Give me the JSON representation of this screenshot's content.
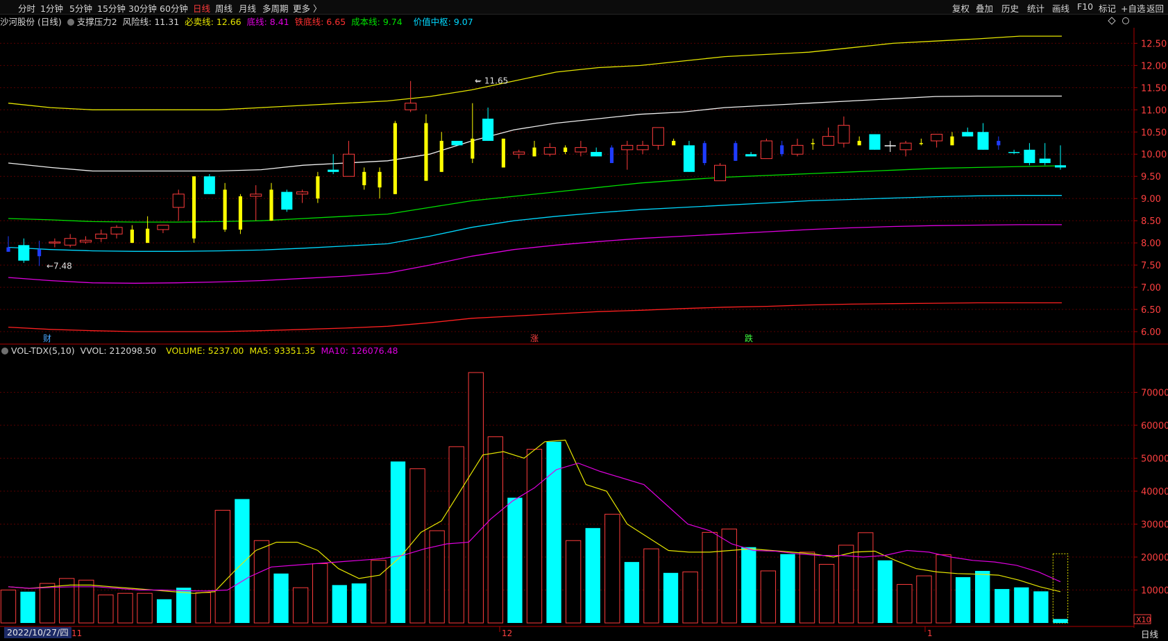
{
  "toolbar": {
    "periods": [
      "分时",
      "1分钟",
      "5分钟",
      "15分钟",
      "30分钟",
      "60分钟",
      "日线",
      "周线",
      "月线",
      "多周期",
      "更多 〉"
    ],
    "active_period": "日线",
    "right_buttons": [
      "复权",
      "叠加",
      "历史",
      "统计",
      "画线",
      "F10",
      "标记",
      "+自选",
      "返回"
    ]
  },
  "info": {
    "stock": "沙河股份 (日线)",
    "indicator": "支撑压力2",
    "risk": "风险线: 11.31",
    "must_sell": "必卖线: 12.66",
    "bottom": "底线: 8.41",
    "iron_bottom": "铁底线: 6.65",
    "cost": "成本线: 9.74",
    "value_center": "价值中枢: 9.07"
  },
  "vol_info": {
    "name": "VOL-TDX(5,10)",
    "vvol": "VVOL: 212098.50",
    "volume": "VOLUME: 5237.00",
    "ma5": "MA5: 93351.35",
    "ma10": "MA10: 126076.48"
  },
  "annotations": {
    "high": "11.65",
    "low": "7.48",
    "cai": "财",
    "zhang": "涨",
    "die": "跌",
    "x10": "X10"
  },
  "x_labels": [
    "11",
    "12",
    "1"
  ],
  "bottom": {
    "date": "2022/10/27/四",
    "period": "日线"
  },
  "colors": {
    "up": "#ff3c3c",
    "down": "#00ffff",
    "yellow_candle": "#ffff00",
    "blue_candle": "#1f3cff",
    "must_sell": "#e6e600",
    "risk": "#f0f0f0",
    "cost": "#00e000",
    "value_center": "#00d8ff",
    "bottom": "#e000e0",
    "iron_bottom": "#ff2020",
    "ma5": "#e6e600",
    "ma10": "#e000e0"
  },
  "chart_data": [
    {
      "type": "candlestick",
      "title": "沙河股份 (日线)",
      "y_ticks": [
        12.5,
        12.0,
        11.5,
        11.0,
        10.5,
        10.0,
        9.5,
        9.0,
        8.5,
        8.0,
        7.5,
        7.0,
        6.5,
        6.0
      ],
      "ylim": [
        5.75,
        12.85
      ],
      "candles": [
        {
          "o": 7.9,
          "h": 8.15,
          "l": 7.8,
          "c": 7.8,
          "t": "down_blue"
        },
        {
          "o": 7.95,
          "h": 8.1,
          "l": 7.55,
          "c": 7.6,
          "t": "down"
        },
        {
          "o": 7.85,
          "h": 8.05,
          "l": 7.48,
          "c": 7.7,
          "t": "down_blue"
        },
        {
          "o": 8.0,
          "h": 8.1,
          "l": 7.9,
          "c": 8.02,
          "t": "up"
        },
        {
          "o": 7.95,
          "h": 8.2,
          "l": 7.9,
          "c": 8.1,
          "t": "up"
        },
        {
          "o": 8.02,
          "h": 8.15,
          "l": 7.98,
          "c": 8.06,
          "t": "up"
        },
        {
          "o": 8.1,
          "h": 8.3,
          "l": 8.02,
          "c": 8.2,
          "t": "up"
        },
        {
          "o": 8.2,
          "h": 8.4,
          "l": 8.1,
          "c": 8.35,
          "t": "up"
        },
        {
          "o": 8.3,
          "h": 8.4,
          "l": 8.0,
          "c": 8.0,
          "t": "down_yellow"
        },
        {
          "o": 8.32,
          "h": 8.6,
          "l": 8.0,
          "c": 8.0,
          "t": "down_yellow"
        },
        {
          "o": 8.3,
          "h": 8.4,
          "l": 8.22,
          "c": 8.4,
          "t": "up"
        },
        {
          "o": 8.8,
          "h": 9.2,
          "l": 8.5,
          "c": 9.1,
          "t": "up"
        },
        {
          "o": 9.5,
          "h": 9.5,
          "l": 8.0,
          "c": 8.1,
          "t": "down_yellow"
        },
        {
          "o": 9.5,
          "h": 9.55,
          "l": 9.1,
          "c": 9.1,
          "t": "down"
        },
        {
          "o": 9.2,
          "h": 9.35,
          "l": 8.25,
          "c": 8.3,
          "t": "down_yellow"
        },
        {
          "o": 9.05,
          "h": 9.1,
          "l": 8.2,
          "c": 8.3,
          "t": "down_yellow"
        },
        {
          "o": 9.05,
          "h": 9.3,
          "l": 8.5,
          "c": 9.1,
          "t": "up"
        },
        {
          "o": 9.2,
          "h": 9.35,
          "l": 8.5,
          "c": 8.5,
          "t": "down_yellow"
        },
        {
          "o": 9.15,
          "h": 9.2,
          "l": 8.7,
          "c": 8.75,
          "t": "down"
        },
        {
          "o": 9.1,
          "h": 9.2,
          "l": 8.9,
          "c": 9.15,
          "t": "up"
        },
        {
          "o": 9.5,
          "h": 9.6,
          "l": 8.9,
          "c": 9.0,
          "t": "down_yellow"
        },
        {
          "o": 9.65,
          "h": 10.0,
          "l": 9.55,
          "c": 9.6,
          "t": "down"
        },
        {
          "o": 9.5,
          "h": 10.3,
          "l": 9.5,
          "c": 10.0,
          "t": "up"
        },
        {
          "o": 9.6,
          "h": 9.7,
          "l": 9.2,
          "c": 9.3,
          "t": "down_yellow"
        },
        {
          "o": 9.6,
          "h": 9.7,
          "l": 9.0,
          "c": 9.25,
          "t": "down_yellow"
        },
        {
          "o": 10.7,
          "h": 10.75,
          "l": 9.1,
          "c": 9.1,
          "t": "down_yellow"
        },
        {
          "o": 11.0,
          "h": 11.65,
          "l": 10.95,
          "c": 11.15,
          "t": "up"
        },
        {
          "o": 10.7,
          "h": 10.9,
          "l": 9.4,
          "c": 9.4,
          "t": "down_yellow"
        },
        {
          "o": 10.3,
          "h": 10.5,
          "l": 9.6,
          "c": 9.6,
          "t": "down_yellow"
        },
        {
          "o": 10.3,
          "h": 10.3,
          "l": 10.2,
          "c": 10.2,
          "t": "down"
        },
        {
          "o": 10.35,
          "h": 11.15,
          "l": 9.8,
          "c": 9.9,
          "t": "down_yellow"
        },
        {
          "o": 10.8,
          "h": 11.05,
          "l": 10.3,
          "c": 10.3,
          "t": "down"
        },
        {
          "o": 10.35,
          "h": 10.35,
          "l": 9.7,
          "c": 9.7,
          "t": "down_yellow"
        },
        {
          "o": 10.0,
          "h": 10.1,
          "l": 9.9,
          "c": 10.05,
          "t": "up"
        },
        {
          "o": 10.15,
          "h": 10.3,
          "l": 9.95,
          "c": 9.95,
          "t": "down_yellow"
        },
        {
          "o": 10.0,
          "h": 10.25,
          "l": 9.95,
          "c": 10.15,
          "t": "up"
        },
        {
          "o": 10.15,
          "h": 10.2,
          "l": 10.0,
          "c": 10.05,
          "t": "down_yellow"
        },
        {
          "o": 10.15,
          "h": 10.3,
          "l": 9.95,
          "c": 10.05,
          "t": "up"
        },
        {
          "o": 10.05,
          "h": 10.15,
          "l": 9.95,
          "c": 9.95,
          "t": "down"
        },
        {
          "o": 10.15,
          "h": 10.2,
          "l": 9.8,
          "c": 9.8,
          "t": "down_blue"
        },
        {
          "o": 10.2,
          "h": 10.3,
          "l": 9.65,
          "c": 10.1,
          "t": "up"
        },
        {
          "o": 10.1,
          "h": 10.3,
          "l": 10.0,
          "c": 10.2,
          "t": "up"
        },
        {
          "o": 10.2,
          "h": 10.6,
          "l": 10.1,
          "c": 10.6,
          "t": "up"
        },
        {
          "o": 10.3,
          "h": 10.35,
          "l": 10.2,
          "c": 10.2,
          "t": "down_yellow"
        },
        {
          "o": 10.2,
          "h": 10.3,
          "l": 9.6,
          "c": 9.6,
          "t": "down"
        },
        {
          "o": 10.25,
          "h": 10.3,
          "l": 9.75,
          "c": 9.8,
          "t": "down_blue"
        },
        {
          "o": 9.4,
          "h": 9.8,
          "l": 9.4,
          "c": 9.75,
          "t": "up"
        },
        {
          "o": 10.25,
          "h": 10.3,
          "l": 9.85,
          "c": 9.85,
          "t": "down_blue"
        },
        {
          "o": 10.0,
          "h": 10.05,
          "l": 9.95,
          "c": 9.95,
          "t": "down"
        },
        {
          "o": 9.9,
          "h": 10.35,
          "l": 9.9,
          "c": 10.3,
          "t": "up"
        },
        {
          "o": 10.2,
          "h": 10.3,
          "l": 9.95,
          "c": 10.0,
          "t": "down_blue"
        },
        {
          "o": 10.0,
          "h": 10.35,
          "l": 9.95,
          "c": 10.2,
          "t": "up"
        },
        {
          "o": 10.25,
          "h": 10.35,
          "l": 10.1,
          "c": 10.25,
          "t": "down_yellow"
        },
        {
          "o": 10.2,
          "h": 10.6,
          "l": 10.2,
          "c": 10.4,
          "t": "up"
        },
        {
          "o": 10.25,
          "h": 10.85,
          "l": 10.15,
          "c": 10.65,
          "t": "up"
        },
        {
          "o": 10.3,
          "h": 10.4,
          "l": 10.2,
          "c": 10.2,
          "t": "down_yellow"
        },
        {
          "o": 10.45,
          "h": 10.45,
          "l": 10.1,
          "c": 10.1,
          "t": "down"
        },
        {
          "o": 10.2,
          "h": 10.3,
          "l": 10.05,
          "c": 10.15,
          "t": "cross"
        },
        {
          "o": 10.1,
          "h": 10.3,
          "l": 9.95,
          "c": 10.25,
          "t": "up"
        },
        {
          "o": 10.25,
          "h": 10.35,
          "l": 10.2,
          "c": 10.25,
          "t": "down_yellow"
        },
        {
          "o": 10.3,
          "h": 10.45,
          "l": 10.15,
          "c": 10.45,
          "t": "up"
        },
        {
          "o": 10.4,
          "h": 10.5,
          "l": 10.2,
          "c": 10.2,
          "t": "down_yellow"
        },
        {
          "o": 10.5,
          "h": 10.6,
          "l": 10.4,
          "c": 10.4,
          "t": "down"
        },
        {
          "o": 10.5,
          "h": 10.7,
          "l": 10.1,
          "c": 10.1,
          "t": "down"
        },
        {
          "o": 10.3,
          "h": 10.4,
          "l": 10.1,
          "c": 10.2,
          "t": "down_blue"
        },
        {
          "o": 10.05,
          "h": 10.1,
          "l": 10.0,
          "c": 10.05,
          "t": "cross_cyan"
        },
        {
          "o": 10.1,
          "h": 10.25,
          "l": 9.75,
          "c": 9.8,
          "t": "down"
        },
        {
          "o": 9.9,
          "h": 10.25,
          "l": 9.75,
          "c": 9.8,
          "t": "down"
        },
        {
          "o": 9.75,
          "h": 10.2,
          "l": 9.65,
          "c": 9.7,
          "t": "down"
        }
      ],
      "lines": [
        {
          "name": "必卖线",
          "color_key": "must_sell",
          "values": [
            11.15,
            11.05,
            11.0,
            11.0,
            11.0,
            11.0,
            11.05,
            11.1,
            11.15,
            11.2,
            11.3,
            11.45,
            11.65,
            11.85,
            11.95,
            12.0,
            12.1,
            12.2,
            12.25,
            12.3,
            12.4,
            12.5,
            12.55,
            12.6,
            12.66,
            12.66
          ]
        },
        {
          "name": "风险线",
          "color_key": "risk",
          "values": [
            9.8,
            9.7,
            9.62,
            9.62,
            9.62,
            9.62,
            9.65,
            9.75,
            9.8,
            9.85,
            10.0,
            10.3,
            10.55,
            10.7,
            10.8,
            10.9,
            10.95,
            11.05,
            11.1,
            11.15,
            11.2,
            11.25,
            11.3,
            11.31,
            11.31,
            11.31
          ]
        },
        {
          "name": "成本线",
          "color_key": "cost",
          "values": [
            8.55,
            8.52,
            8.48,
            8.47,
            8.47,
            8.48,
            8.5,
            8.55,
            8.6,
            8.65,
            8.8,
            8.95,
            9.05,
            9.15,
            9.25,
            9.35,
            9.42,
            9.48,
            9.52,
            9.56,
            9.6,
            9.64,
            9.68,
            9.7,
            9.72,
            9.74
          ]
        },
        {
          "name": "价值中枢",
          "color_key": "value_center",
          "values": [
            7.9,
            7.85,
            7.82,
            7.81,
            7.81,
            7.82,
            7.84,
            7.88,
            7.93,
            7.98,
            8.15,
            8.35,
            8.5,
            8.6,
            8.68,
            8.75,
            8.8,
            8.85,
            8.9,
            8.95,
            8.98,
            9.01,
            9.04,
            9.06,
            9.07,
            9.07
          ]
        },
        {
          "name": "底线",
          "color_key": "bottom",
          "values": [
            7.22,
            7.15,
            7.1,
            7.09,
            7.1,
            7.12,
            7.15,
            7.2,
            7.25,
            7.32,
            7.5,
            7.7,
            7.85,
            7.95,
            8.03,
            8.1,
            8.15,
            8.2,
            8.25,
            8.3,
            8.34,
            8.37,
            8.39,
            8.4,
            8.41,
            8.41
          ]
        },
        {
          "name": "铁底线",
          "color_key": "iron_bottom",
          "values": [
            6.1,
            6.05,
            6.02,
            6.0,
            6.0,
            6.0,
            6.02,
            6.05,
            6.08,
            6.12,
            6.2,
            6.3,
            6.35,
            6.4,
            6.45,
            6.48,
            6.52,
            6.55,
            6.57,
            6.6,
            6.62,
            6.63,
            6.64,
            6.65,
            6.65,
            6.65
          ]
        }
      ]
    },
    {
      "type": "bar",
      "title": "VOL-TDX(5,10)",
      "y_ticks": [
        70000,
        60000,
        50000,
        40000,
        30000,
        20000,
        10000
      ],
      "ylim": [
        0,
        80000
      ],
      "volumes": [
        10000,
        9500,
        12000,
        13500,
        13000,
        8500,
        9000,
        9000,
        7200,
        10700,
        9200,
        34200,
        37600,
        25000,
        15000,
        10700,
        18000,
        11500,
        12000,
        19000,
        49000,
        46800,
        28000,
        53500,
        76000,
        56500,
        38000,
        52700,
        55000,
        25000,
        28800,
        33000,
        18500,
        22500,
        15200,
        15500,
        27500,
        28500,
        23000,
        15800,
        20900,
        21500,
        17800,
        23600,
        27400,
        19000,
        11700,
        14300,
        20700,
        13900,
        15800,
        10300,
        10800,
        9600,
        1200
      ],
      "vol_types": [
        "up",
        "down",
        "up",
        "up",
        "up",
        "up",
        "up",
        "up",
        "down",
        "down",
        "up",
        "up",
        "down",
        "up",
        "down",
        "up",
        "up",
        "down",
        "down",
        "up",
        "down",
        "up",
        "up",
        "up",
        "up",
        "up",
        "down",
        "up",
        "down",
        "up",
        "down",
        "up",
        "down",
        "up",
        "down",
        "up",
        "up",
        "up",
        "down",
        "up",
        "down",
        "up",
        "up",
        "up",
        "up",
        "down",
        "up",
        "up",
        "up",
        "down",
        "down",
        "down",
        "down",
        "down",
        "down"
      ],
      "ma5": [
        11000,
        10500,
        11000,
        11500,
        11500,
        11000,
        10500,
        10000,
        9500,
        9000,
        9500,
        16000,
        22000,
        24500,
        24500,
        22000,
        16500,
        13500,
        14500,
        20000,
        27500,
        31000,
        41000,
        51000,
        52000,
        50000,
        55000,
        55500,
        42000,
        40000,
        30000,
        26000,
        22000,
        21500,
        21500,
        22000,
        22500,
        22000,
        21500,
        21000,
        20000,
        21500,
        21800,
        19000,
        16500,
        15500,
        15000,
        14800,
        14500,
        13000,
        11000,
        9500
      ],
      "ma10": [
        11000,
        10500,
        10800,
        11000,
        11000,
        10500,
        10000,
        10000,
        9800,
        9700,
        10000,
        14000,
        17000,
        17500,
        18000,
        18500,
        19000,
        19500,
        20500,
        22500,
        24000,
        24500,
        31500,
        37000,
        41000,
        46500,
        48500,
        46000,
        44000,
        42000,
        36000,
        30000,
        28000,
        24000,
        22000,
        21800,
        21000,
        20500,
        20500,
        20000,
        20500,
        22000,
        21500,
        20000,
        19000,
        18500,
        17500,
        15500,
        12500
      ]
    }
  ]
}
